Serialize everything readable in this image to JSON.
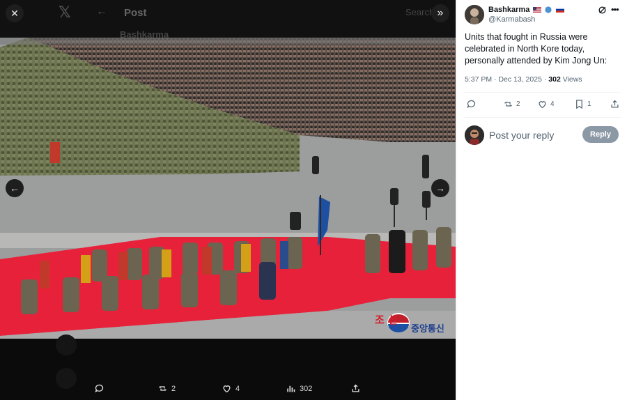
{
  "viewer": {
    "bg_post_title": "Post",
    "bg_username": "Bashkarma",
    "bg_search": "Search",
    "close_label": "✕",
    "collapse_label": "»",
    "prev_label": "←",
    "next_label": "→",
    "watermark_line1": "조 선",
    "watermark_line2": "중앙통신",
    "bottom_bar": {
      "reply_count": "",
      "repost_count": "2",
      "like_count": "4",
      "views_count": "302"
    }
  },
  "post": {
    "author_name": "Bashkarma",
    "author_handle": "@Karmabash",
    "flags": [
      "us-flag",
      "globe-icon",
      "russia-flag"
    ],
    "text": "Units that fought in Russia were celebrated in North Kore today, personally attended by Kim Jong Un:",
    "time": "5:37 PM",
    "date": "Dec 13, 2025",
    "views_number": "302",
    "views_label": "Views",
    "reposts": "2",
    "likes": "4",
    "bookmarks": "1"
  },
  "reply": {
    "placeholder": "Post your reply",
    "button_label": "Reply"
  },
  "colors": {
    "carpet": "#e8213a",
    "panel_bg": "#ffffff",
    "reply_button": "#8b98a5",
    "secondary_text": "#536471"
  }
}
